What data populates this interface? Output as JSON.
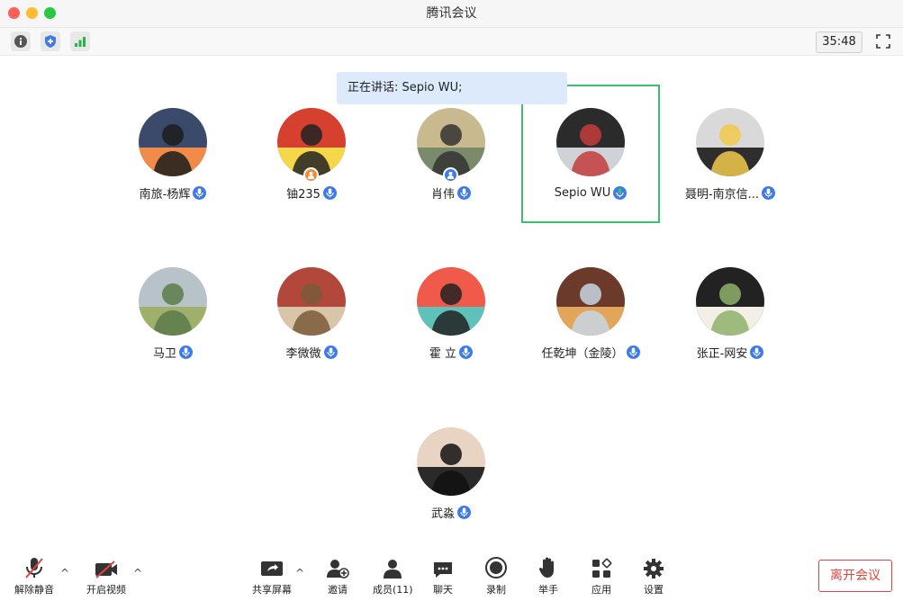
{
  "window": {
    "title": "腾讯会议"
  },
  "infobar": {
    "timer": "35:48"
  },
  "speaking": {
    "text": "正在讲话: Sepio WU;"
  },
  "participants": [
    {
      "name": "南旅-杨辉",
      "mic": "on",
      "row": 0,
      "col": 0
    },
    {
      "name": "铀235",
      "mic": "on",
      "row": 0,
      "col": 1,
      "badge": "host"
    },
    {
      "name": "肖伟",
      "mic": "on",
      "row": 0,
      "col": 2,
      "badge": "cohost"
    },
    {
      "name": "Sepio WU",
      "mic": "speaking",
      "row": 0,
      "col": 3
    },
    {
      "name": "聂明-南京信...",
      "mic": "on",
      "row": 0,
      "col": 4
    },
    {
      "name": "马卫",
      "mic": "on",
      "row": 1,
      "col": 0
    },
    {
      "name": "李微微",
      "mic": "on",
      "row": 1,
      "col": 1
    },
    {
      "name": "霍 立",
      "mic": "on",
      "row": 1,
      "col": 2
    },
    {
      "name": "任乾坤（金陵）",
      "mic": "on",
      "row": 1,
      "col": 3
    },
    {
      "name": "张正-网安",
      "mic": "on",
      "row": 1,
      "col": 4
    },
    {
      "name": "武淼",
      "mic": "on",
      "row": 2,
      "col": 2
    }
  ],
  "toolbar": {
    "unmute": "解除静音",
    "start_video": "开启视频",
    "share_screen": "共享屏幕",
    "invite": "邀请",
    "members": "成员(11)",
    "chat": "聊天",
    "record": "录制",
    "raise_hand": "举手",
    "apps": "应用",
    "settings": "设置",
    "leave": "离开会议"
  },
  "colors": {
    "accent": "#3d7be8",
    "speaking_frame": "#3cbf6e",
    "leave": "#e0453d",
    "banner": "#dceafc"
  }
}
